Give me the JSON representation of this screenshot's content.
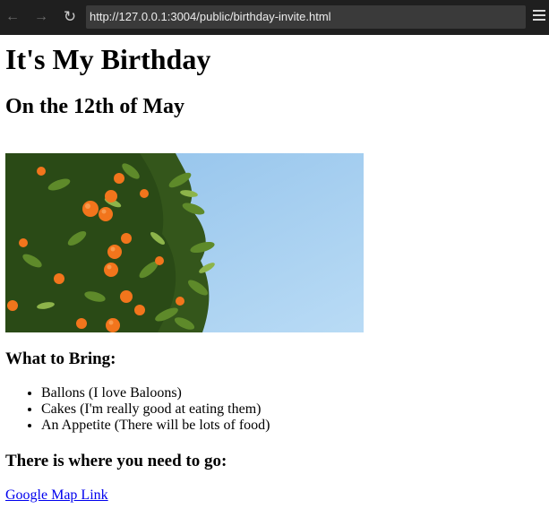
{
  "browser": {
    "url": "http://127.0.0.1:3004/public/birthday-invite.html",
    "back_icon": "←",
    "forward_icon": "→",
    "reload_icon": "↻"
  },
  "page": {
    "title": "It's My Birthday",
    "date": "On the 12th of May",
    "image_alt": "orange tree against blue sky",
    "bring_heading": "What to Bring:",
    "bring_items": [
      "Ballons (I love Baloons)",
      "Cakes (I'm really good at eating them)",
      "An Appetite (There will be lots of food)"
    ],
    "go_heading": "There is where you need to go:",
    "map_link": "Google Map Link"
  },
  "colors": {
    "toolbar": "#1f1f1f",
    "urlbar": "#3a3a3a",
    "link": "#0000ee",
    "sky": "#a9cff0",
    "orange": "#f2751c",
    "leaf": "#3f6620"
  }
}
